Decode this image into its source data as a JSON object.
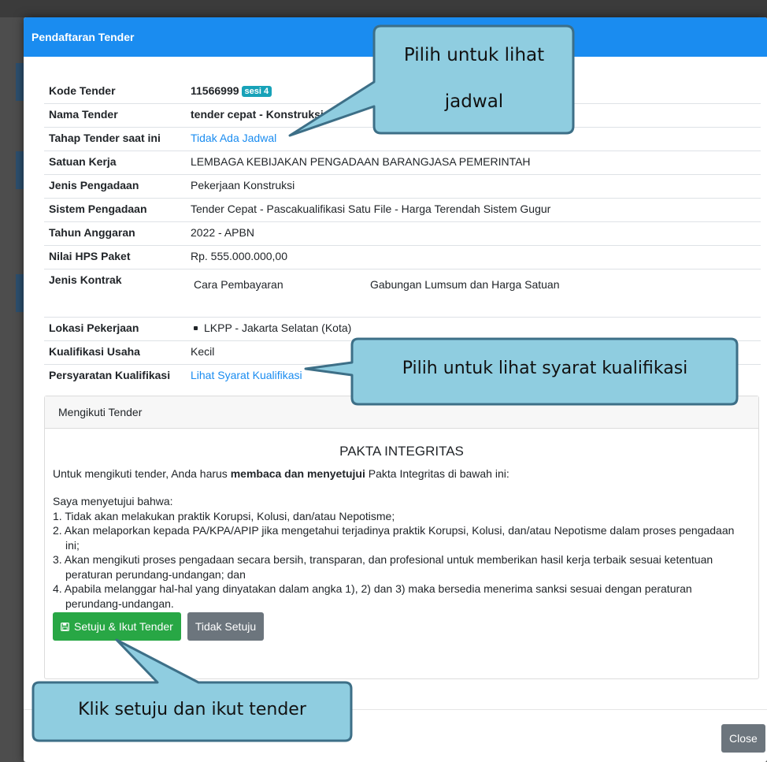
{
  "modal": {
    "title": "Pendaftaran Tender",
    "close_label": "Close"
  },
  "details": {
    "kode_label": "Kode Tender",
    "kode_value": "11566999",
    "kode_badge": "sesi 4",
    "nama_label": "Nama Tender",
    "nama_value": "tender cepat - Konstruksi",
    "tahap_label": "Tahap Tender saat ini",
    "tahap_value": "Tidak Ada Jadwal",
    "satuan_label": "Satuan Kerja",
    "satuan_value": "LEMBAGA KEBIJAKAN PENGADAAN BARANGJASA PEMERINTAH",
    "jenis_label": "Jenis Pengadaan",
    "jenis_value": "Pekerjaan Konstruksi",
    "sistem_label": "Sistem Pengadaan",
    "sistem_value": "Tender Cepat - Pascakualifikasi Satu File - Harga Terendah Sistem Gugur",
    "tahun_label": "Tahun Anggaran",
    "tahun_value": "2022 - APBN",
    "hps_label": "Nilai HPS Paket",
    "hps_value": "Rp. 555.000.000,00",
    "kontrak_label": "Jenis Kontrak",
    "kontrak_key": "Cara Pembayaran",
    "kontrak_value": "Gabungan Lumsum dan Harga Satuan",
    "lokasi_label": "Lokasi Pekerjaan",
    "lokasi_value": "LKPP - Jakarta Selatan (Kota)",
    "kualifikasi_label": "Kualifikasi Usaha",
    "kualifikasi_value": "Kecil",
    "persyaratan_label": "Persyaratan Kualifikasi",
    "persyaratan_value": "Lihat Syarat Kualifikasi"
  },
  "card": {
    "header": "Mengikuti Tender",
    "pakta_title": "PAKTA INTEGRITAS",
    "intro_before": "Untuk mengikuti tender, Anda harus ",
    "intro_bold": "membaca dan menyetujui",
    "intro_after": " Pakta Integritas di bawah ini:",
    "agree_heading": "Saya menyetujui bahwa:",
    "items": [
      "1. Tidak akan melakukan praktik Korupsi, Kolusi, dan/atau Nepotisme;",
      "2. Akan melaporkan kepada PA/KPA/APIP jika mengetahui terjadinya praktik Korupsi, Kolusi, dan/atau Nepotisme dalam proses pengadaan ini;",
      "3. Akan mengikuti proses pengadaan secara bersih, transparan, dan profesional untuk memberikan hasil kerja terbaik sesuai ketentuan peraturan perundang-undangan; dan",
      "4. Apabila melanggar hal-hal yang dinyatakan dalam angka 1), 2) dan 3) maka bersedia menerima sanksi sesuai dengan peraturan perundang-undangan."
    ],
    "agree_button": "Setuju & Ikut Tender",
    "disagree_button": "Tidak Setuju"
  },
  "callouts": {
    "jadwal_line1": "Pilih untuk lihat",
    "jadwal_line2": "jadwal",
    "syarat": "Pilih untuk lihat syarat kualifikasi",
    "setuju": "Klik setuju dan ikut tender"
  },
  "colors": {
    "header_blue": "#1a8cf0",
    "callout_fill": "#8fcde0",
    "callout_border": "#3d6f87",
    "success_green": "#28a745",
    "badge_teal": "#17a2b8"
  }
}
